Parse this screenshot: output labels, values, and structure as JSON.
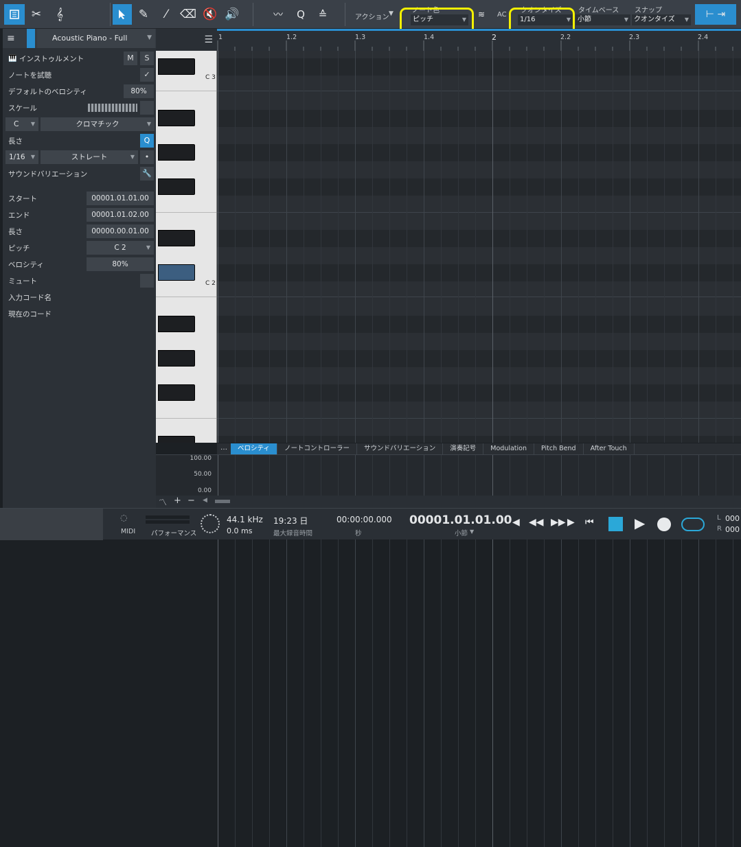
{
  "toolbar": {
    "action_label": "アクション",
    "note_color_label": "ノート色",
    "note_color_value": "ピッチ",
    "audition_label": "AC",
    "quantize_label": "クオンタイズ",
    "quantize_value": "1/16",
    "timebase_label": "タイムベース",
    "timebase_value": "小節",
    "snap_label": "スナップ",
    "snap_value": "クオンタイズ"
  },
  "inspector": {
    "track_name": "Acoustic Piano - Full",
    "instrument_label": "インストゥルメント",
    "mute_label": "M",
    "solo_label": "S",
    "audition_notes_label": "ノートを試聴",
    "default_velocity_label": "デフォルトのベロシティ",
    "default_velocity_value": "80%",
    "scale_label": "スケール",
    "scale_root": "C",
    "scale_type": "クロマチック",
    "length_label": "長さ",
    "length_value": "1/16",
    "length_mode": "ストレート",
    "sound_variation_label": "サウンドバリエーション",
    "start_label": "スタート",
    "start_value": "00001.01.01.00",
    "end_label": "エンド",
    "end_value": "00001.01.02.00",
    "note_length_label": "長さ",
    "note_length_value": "00000.00.01.00",
    "pitch_label": "ピッチ",
    "pitch_value": "C 2",
    "velocity_label": "ベロシティ",
    "velocity_value": "80%",
    "mute_row_label": "ミュート",
    "input_chord_label": "入力コード名",
    "current_chord_label": "現在のコード"
  },
  "keyboard": {
    "c3_label": "C 3",
    "c2_label": "C 2"
  },
  "ruler": {
    "ticks": [
      "1",
      "1.2",
      "1.3",
      "1.4",
      "2",
      "2.2",
      "2.3",
      "2.4"
    ]
  },
  "lower_tabs": {
    "more_label": "…",
    "tabs": [
      "ベロシティ",
      "ノートコントローラー",
      "サウンドバリエーション",
      "演奏記号",
      "Modulation",
      "Pitch Bend",
      "After Touch"
    ]
  },
  "velocity_lane": {
    "max_label": "100.00",
    "mid_label": "50.00",
    "min_label": "0.00"
  },
  "transport": {
    "midi_label": "MIDI",
    "performance_label": "パフォーマンス",
    "sample_rate": "44.1 kHz",
    "latency": "0.0 ms",
    "record_time": "19:23 日",
    "record_time_label": "最大録音時間",
    "seconds_value": "00:00:00.000",
    "seconds_label": "秒",
    "bars_value": "00001.01.01.00",
    "bars_label": "小節",
    "left_label": "L",
    "left_value": "000",
    "right_label": "R",
    "right_value": "000"
  },
  "colors": {
    "accent": "#2a8ecf",
    "highlight": "#f4f000"
  }
}
